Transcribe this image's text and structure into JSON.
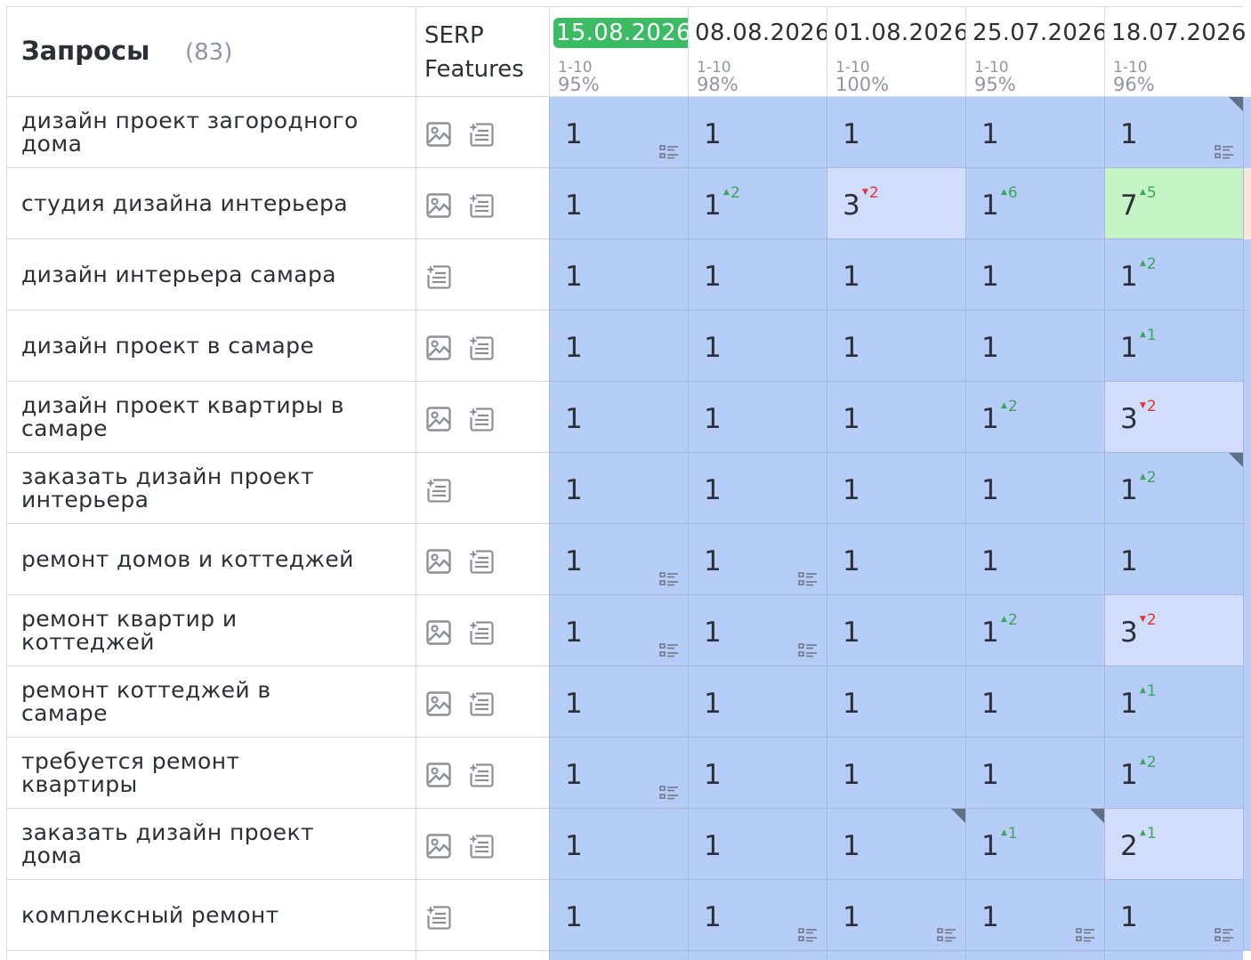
{
  "header": {
    "queries_title": "Запросы",
    "queries_count": "(83)",
    "serp_line1": "SERP",
    "serp_line2": "Features"
  },
  "dates": [
    {
      "date": "15.08.2026",
      "range": "1-10",
      "percent": "95%",
      "active": true
    },
    {
      "date": "08.08.2026",
      "range": "1-10",
      "percent": "98%",
      "active": false
    },
    {
      "date": "01.08.2026",
      "range": "1-10",
      "percent": "100%",
      "active": false
    },
    {
      "date": "25.07.2026",
      "range": "1-10",
      "percent": "95%",
      "active": false
    },
    {
      "date": "18.07.2026",
      "range": "1-10",
      "percent": "96%",
      "active": false
    }
  ],
  "colors": {
    "top1": "#b6cdf8",
    "top3": "#d1ddfa",
    "top10": "#c4f4c6",
    "active_date": "#3dbb64",
    "up": "#3aa65a",
    "down": "#e0303a",
    "edge_tint": "#fbe6df"
  },
  "rows": [
    {
      "query": "дизайн проект загородного дома",
      "serp": [
        "image-icon",
        "ai-answer-icon"
      ],
      "edge": "blue",
      "cells": [
        {
          "pos": "1",
          "snippet": true
        },
        {
          "pos": "1"
        },
        {
          "pos": "1"
        },
        {
          "pos": "1"
        },
        {
          "pos": "1",
          "snippet": true,
          "corner": true
        }
      ]
    },
    {
      "query": "студия дизайна интерьера",
      "serp": [
        "image-icon",
        "ai-answer-icon"
      ],
      "edge": "pink",
      "cells": [
        {
          "pos": "1"
        },
        {
          "pos": "1",
          "delta": "2",
          "dir": "up"
        },
        {
          "pos": "3",
          "delta": "2",
          "dir": "down"
        },
        {
          "pos": "1",
          "delta": "6",
          "dir": "up"
        },
        {
          "pos": "7",
          "delta": "5",
          "dir": "up"
        }
      ]
    },
    {
      "query": "дизайн интерьера самара",
      "serp": [
        "ai-answer-icon"
      ],
      "edge": "blue",
      "cells": [
        {
          "pos": "1"
        },
        {
          "pos": "1"
        },
        {
          "pos": "1"
        },
        {
          "pos": "1"
        },
        {
          "pos": "1",
          "delta": "2",
          "dir": "up"
        }
      ]
    },
    {
      "query": "дизайн проект в самаре",
      "serp": [
        "image-icon",
        "ai-answer-icon"
      ],
      "edge": "blue",
      "cells": [
        {
          "pos": "1"
        },
        {
          "pos": "1"
        },
        {
          "pos": "1"
        },
        {
          "pos": "1"
        },
        {
          "pos": "1",
          "delta": "1",
          "dir": "up"
        }
      ]
    },
    {
      "query": "дизайн проект квартиры в самаре",
      "serp": [
        "image-icon",
        "ai-answer-icon"
      ],
      "edge": "blue",
      "cells": [
        {
          "pos": "1"
        },
        {
          "pos": "1"
        },
        {
          "pos": "1"
        },
        {
          "pos": "1",
          "delta": "2",
          "dir": "up"
        },
        {
          "pos": "3",
          "delta": "2",
          "dir": "down"
        }
      ]
    },
    {
      "query": "заказать дизайн проект интерьера",
      "serp": [
        "ai-answer-icon"
      ],
      "edge": "blue",
      "cells": [
        {
          "pos": "1"
        },
        {
          "pos": "1"
        },
        {
          "pos": "1"
        },
        {
          "pos": "1"
        },
        {
          "pos": "1",
          "delta": "2",
          "dir": "up",
          "corner": true
        }
      ]
    },
    {
      "query": "ремонт домов и коттеджей",
      "serp": [
        "image-icon",
        "ai-answer-icon"
      ],
      "edge": "blue",
      "cells": [
        {
          "pos": "1",
          "snippet": true
        },
        {
          "pos": "1",
          "snippet": true
        },
        {
          "pos": "1"
        },
        {
          "pos": "1"
        },
        {
          "pos": "1"
        }
      ]
    },
    {
      "query": "ремонт квартир и коттеджей",
      "serp": [
        "image-icon",
        "ai-answer-icon"
      ],
      "edge": "blue",
      "cells": [
        {
          "pos": "1",
          "snippet": true
        },
        {
          "pos": "1",
          "snippet": true
        },
        {
          "pos": "1"
        },
        {
          "pos": "1",
          "delta": "2",
          "dir": "up"
        },
        {
          "pos": "3",
          "delta": "2",
          "dir": "down"
        }
      ]
    },
    {
      "query": "ремонт коттеджей в самаре",
      "serp": [
        "image-icon",
        "ai-answer-icon"
      ],
      "edge": "blue",
      "cells": [
        {
          "pos": "1"
        },
        {
          "pos": "1"
        },
        {
          "pos": "1"
        },
        {
          "pos": "1"
        },
        {
          "pos": "1",
          "delta": "1",
          "dir": "up"
        }
      ]
    },
    {
      "query": "требуется ремонт квартиры",
      "serp": [
        "image-icon",
        "ai-answer-icon"
      ],
      "edge": "blue",
      "cells": [
        {
          "pos": "1",
          "snippet": true
        },
        {
          "pos": "1"
        },
        {
          "pos": "1"
        },
        {
          "pos": "1"
        },
        {
          "pos": "1",
          "delta": "2",
          "dir": "up"
        }
      ]
    },
    {
      "query": "заказать дизайн проект дома",
      "serp": [
        "image-icon",
        "ai-answer-icon"
      ],
      "edge": "blue",
      "cells": [
        {
          "pos": "1"
        },
        {
          "pos": "1"
        },
        {
          "pos": "1",
          "corner": true
        },
        {
          "pos": "1",
          "delta": "1",
          "dir": "up",
          "corner": true
        },
        {
          "pos": "2",
          "delta": "1",
          "dir": "up"
        }
      ]
    },
    {
      "query": "комплексный ремонт",
      "serp": [
        "ai-answer-icon"
      ],
      "edge": "blue",
      "cells": [
        {
          "pos": "1"
        },
        {
          "pos": "1",
          "snippet": true
        },
        {
          "pos": "1",
          "snippet": true
        },
        {
          "pos": "1",
          "snippet": true
        },
        {
          "pos": "1",
          "snippet": true
        }
      ]
    }
  ]
}
